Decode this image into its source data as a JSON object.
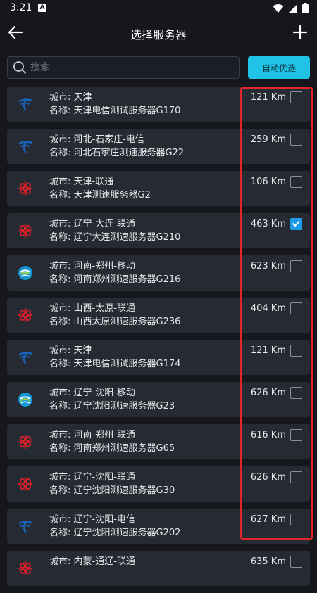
{
  "status_bar": {
    "time": "3:21",
    "notification_icon": "A"
  },
  "app_bar": {
    "title": "选择服务器",
    "back_icon": "back-arrow-icon",
    "add_icon": "plus-icon"
  },
  "search": {
    "placeholder": "搜索",
    "value": ""
  },
  "auto_button": {
    "label": "自动优选"
  },
  "labels": {
    "city_prefix": "城市: ",
    "name_prefix": "名称: "
  },
  "servers": [
    {
      "isp": "telecom",
      "city": "天津",
      "name": "天津电信测试服务器G170",
      "distance": "121 Km",
      "checked": false
    },
    {
      "isp": "telecom",
      "city": "河北-石家庄-电信",
      "name": "河北石家庄测速服务器G22",
      "distance": "259 Km",
      "checked": false
    },
    {
      "isp": "unicom",
      "city": "天津-联通",
      "name": "天津测速服务器G2",
      "distance": "106 Km",
      "checked": false
    },
    {
      "isp": "unicom",
      "city": "辽宁-大连-联通",
      "name": "辽宁大连测速服务器G210",
      "distance": "463 Km",
      "checked": true
    },
    {
      "isp": "mobile",
      "city": "河南-郑州-移动",
      "name": "河南郑州测速服务器G216",
      "distance": "623 Km",
      "checked": false
    },
    {
      "isp": "unicom",
      "city": "山西-太原-联通",
      "name": "山西太原测速服务器G236",
      "distance": "404 Km",
      "checked": false
    },
    {
      "isp": "telecom",
      "city": "天津",
      "name": "天津电信测试服务器G174",
      "distance": "121 Km",
      "checked": false
    },
    {
      "isp": "mobile",
      "city": "辽宁-沈阳-移动",
      "name": "辽宁沈阳测速服务器G23",
      "distance": "626 Km",
      "checked": false
    },
    {
      "isp": "unicom",
      "city": "河南-郑州-联通",
      "name": "河南郑州测速服务器G65",
      "distance": "616 Km",
      "checked": false
    },
    {
      "isp": "unicom",
      "city": "辽宁-沈阳-联通",
      "name": "辽宁沈阳测速服务器G30",
      "distance": "626 Km",
      "checked": false
    },
    {
      "isp": "telecom",
      "city": "辽宁-沈阳-电信",
      "name": "辽宁沈阳测速服务器G202",
      "distance": "627 Km",
      "checked": false
    },
    {
      "isp": "unicom",
      "city": "内蒙-通辽-联通",
      "name": "",
      "distance": "635 Km",
      "checked": false
    }
  ],
  "colors": {
    "background": "#15171d",
    "card": "#262a33",
    "accent": "#1fc3e5",
    "checkbox_checked": "#1e9be8",
    "highlight": "#e0262b"
  }
}
